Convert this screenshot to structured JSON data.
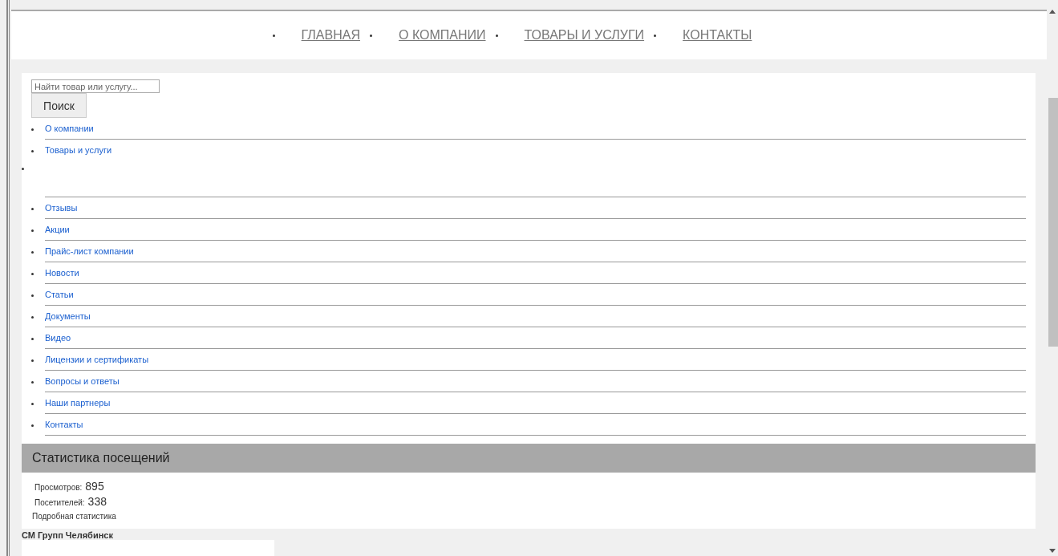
{
  "nav": [
    {
      "label": "ГЛАВНАЯ"
    },
    {
      "label": "О КОМПАНИИ"
    },
    {
      "label": "ТОВАРЫ И УСЛУГИ"
    },
    {
      "label": "КОНТАКТЫ"
    }
  ],
  "search": {
    "placeholder": "Найти товар или услугу...",
    "button": "Поиск"
  },
  "menu": [
    {
      "label": "О компании",
      "kind": "link"
    },
    {
      "label": "Товары и услуги",
      "kind": "group"
    },
    {
      "label": "Отзывы",
      "kind": "link"
    },
    {
      "label": "Акции",
      "kind": "link"
    },
    {
      "label": "Прайс-лист компании",
      "kind": "link"
    },
    {
      "label": "Новости",
      "kind": "link"
    },
    {
      "label": "Статьи",
      "kind": "link"
    },
    {
      "label": "Документы",
      "kind": "link"
    },
    {
      "label": "Видео",
      "kind": "link"
    },
    {
      "label": "Лицензии и сертификаты",
      "kind": "link"
    },
    {
      "label": "Вопросы и ответы",
      "kind": "link"
    },
    {
      "label": "Наши партнеры",
      "kind": "link"
    },
    {
      "label": "Контакты",
      "kind": "link"
    }
  ],
  "stats": {
    "title": "Статистика посещений",
    "rows": [
      {
        "label": "Просмотров:",
        "value": "895"
      },
      {
        "label": "Посетителей:",
        "value": "338"
      }
    ],
    "link": "Подробная статистика"
  },
  "footer": {
    "company": "СМ Групп Челябинск"
  }
}
